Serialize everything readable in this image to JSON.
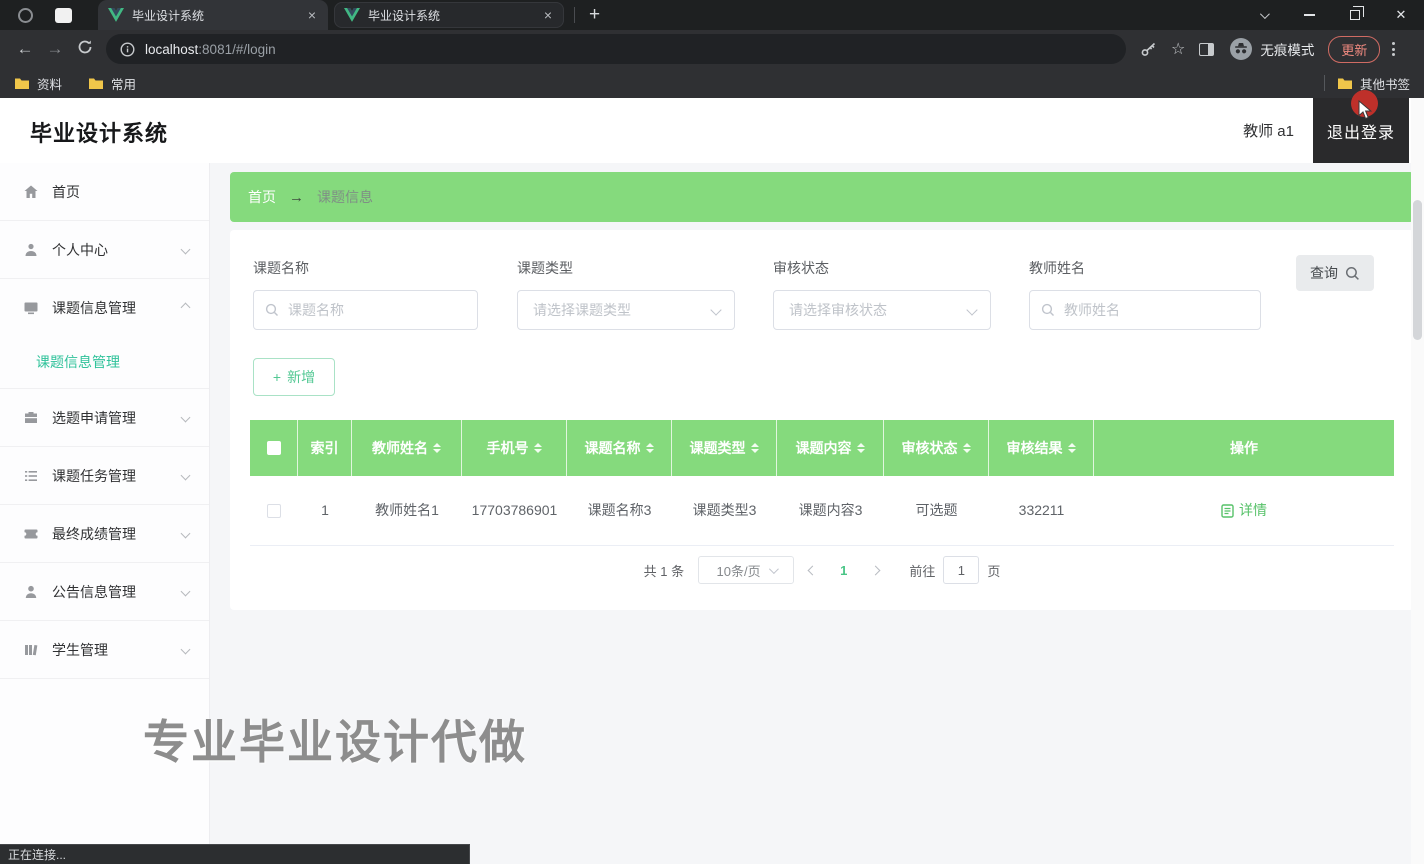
{
  "browser": {
    "tabs": [
      {
        "title": "毕业设计系统"
      },
      {
        "title": "毕业设计系统"
      }
    ],
    "url_host": "localhost",
    "url_rest": ":8081/#/login",
    "incognito_label": "无痕模式",
    "update_label": "更新",
    "bookmarks": [
      "资料",
      "常用"
    ],
    "other_bookmarks": "其他书签"
  },
  "header": {
    "title": "毕业设计系统",
    "user": "教师 a1",
    "logout": "退出登录"
  },
  "sidebar": {
    "items": [
      {
        "label": "首页"
      },
      {
        "label": "个人中心"
      },
      {
        "label": "课题信息管理"
      },
      {
        "label": "课题信息管理"
      },
      {
        "label": "选题申请管理"
      },
      {
        "label": "课题任务管理"
      },
      {
        "label": "最终成绩管理"
      },
      {
        "label": "公告信息管理"
      },
      {
        "label": "学生管理"
      }
    ]
  },
  "breadcrumb": {
    "home": "首页",
    "current": "课题信息"
  },
  "filters": [
    {
      "label": "课题名称",
      "placeholder": "课题名称"
    },
    {
      "label": "课题类型",
      "placeholder": "请选择课题类型"
    },
    {
      "label": "审核状态",
      "placeholder": "请选择审核状态"
    },
    {
      "label": "教师姓名",
      "placeholder": "教师姓名"
    }
  ],
  "toolbar": {
    "search_label": "查询",
    "add_label": "新增"
  },
  "table": {
    "columns": [
      {
        "label": "索引"
      },
      {
        "label": "教师姓名"
      },
      {
        "label": "手机号"
      },
      {
        "label": "课题名称"
      },
      {
        "label": "课题类型"
      },
      {
        "label": "课题内容"
      },
      {
        "label": "审核状态"
      },
      {
        "label": "审核结果"
      },
      {
        "label": "操作"
      }
    ],
    "row": {
      "index": "1",
      "teacher_name": "教师姓名1",
      "phone": "17703786901",
      "topic_name": "课题名称3",
      "topic_type": "课题类型3",
      "topic_content": "课题内容3",
      "audit_status": "可选题",
      "audit_result": "332211",
      "action": "详情"
    }
  },
  "pagination": {
    "total": "共 1 条",
    "page_size": "10条/页",
    "current": "1",
    "goto_label": "前往",
    "goto_value": "1",
    "unit_label": "页"
  },
  "watermark": "专业毕业设计代做",
  "statusbar": "正在连接...",
  "colors": {
    "accent_green": "#85da7d",
    "sidebar_active": "#2fc29a",
    "link_green": "#57c269",
    "update_red": "#f08a80"
  }
}
